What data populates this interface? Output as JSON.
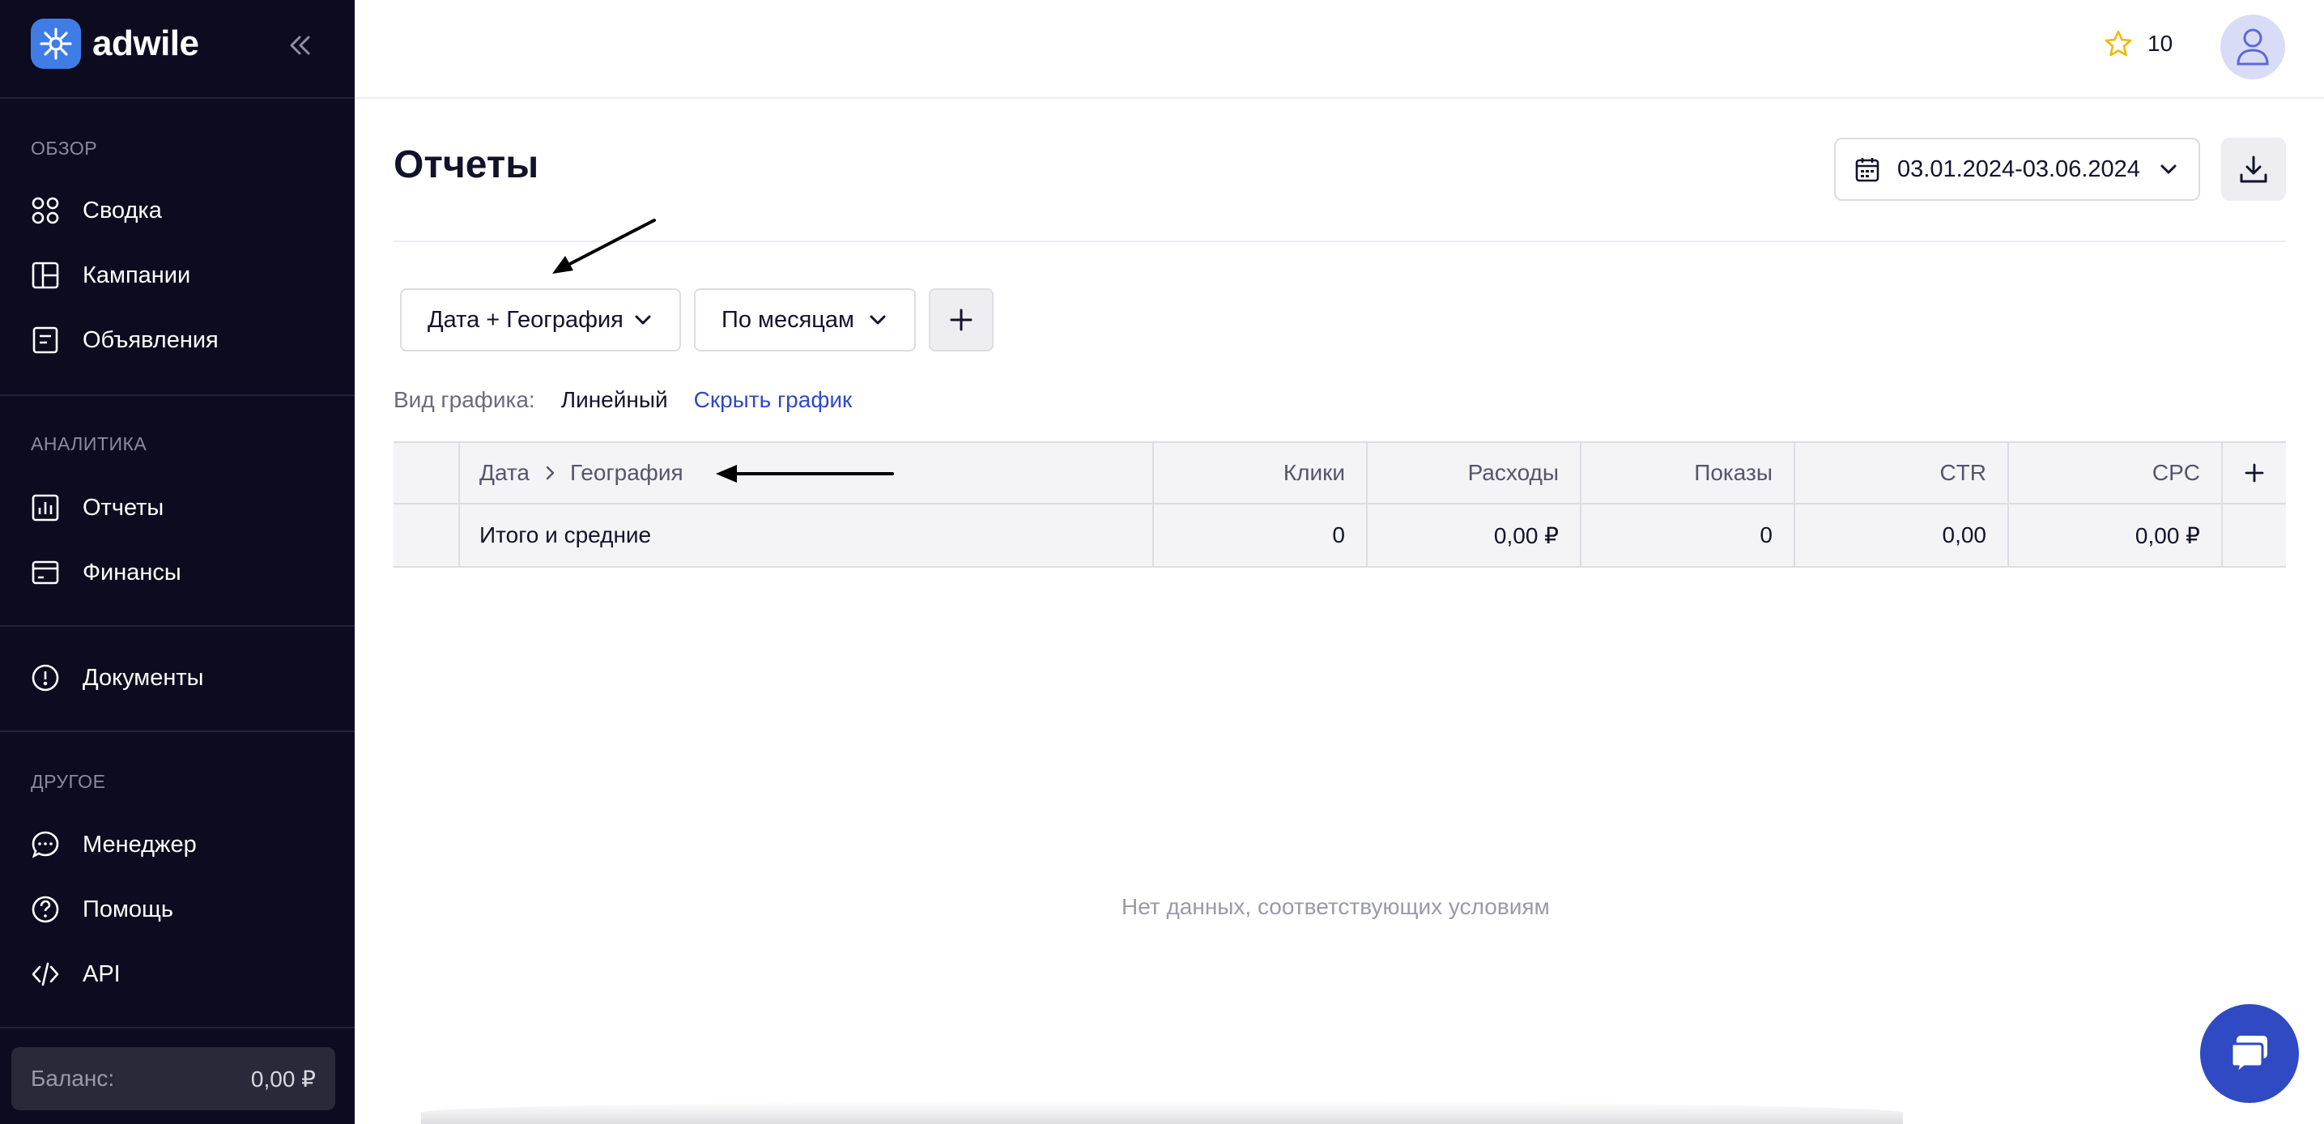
{
  "brand": {
    "name": "adwile"
  },
  "sidebar": {
    "sections": [
      {
        "title": "ОБЗОР",
        "items": [
          {
            "label": "Сводка",
            "icon": "grid-icon"
          },
          {
            "label": "Кампании",
            "icon": "layout-icon"
          },
          {
            "label": "Объявления",
            "icon": "document-icon"
          }
        ]
      },
      {
        "title": "АНАЛИТИКА",
        "items": [
          {
            "label": "Отчеты",
            "icon": "chart-icon"
          },
          {
            "label": "Финансы",
            "icon": "card-icon"
          }
        ]
      },
      {
        "title": "",
        "items": [
          {
            "label": "Документы",
            "icon": "alert-circle-icon"
          }
        ]
      },
      {
        "title": "ДРУГОЕ",
        "items": [
          {
            "label": "Менеджер",
            "icon": "chat-icon"
          },
          {
            "label": "Помощь",
            "icon": "help-icon"
          },
          {
            "label": "API",
            "icon": "code-icon"
          }
        ]
      }
    ],
    "balance": {
      "label": "Баланс:",
      "value": "0,00 ₽"
    }
  },
  "header": {
    "favorites_count": "10"
  },
  "page": {
    "title": "Отчеты",
    "date_range": "03.01.2024-03.06.2024",
    "grouping": "Дата + География",
    "period": "По месяцам",
    "chart_type_label": "Вид графика:",
    "chart_type_value": "Линейный",
    "hide_chart_link": "Скрыть график"
  },
  "table": {
    "breadcrumb": [
      "Дата",
      "География"
    ],
    "columns": [
      "Клики",
      "Расходы",
      "Показы",
      "CTR",
      "CPC"
    ],
    "total_row": {
      "label": "Итого и средние",
      "values": [
        "0",
        "0,00 ₽",
        "0",
        "0,00",
        "0,00 ₽"
      ]
    },
    "empty_message": "Нет данных, соответствующих условиям"
  },
  "colors": {
    "sidebar_bg": "#0d0b1f",
    "brand_blue": "#3f7ce6",
    "link_blue": "#2f49c9",
    "chat_button": "#2f4ac2",
    "star": "#f3b800"
  }
}
